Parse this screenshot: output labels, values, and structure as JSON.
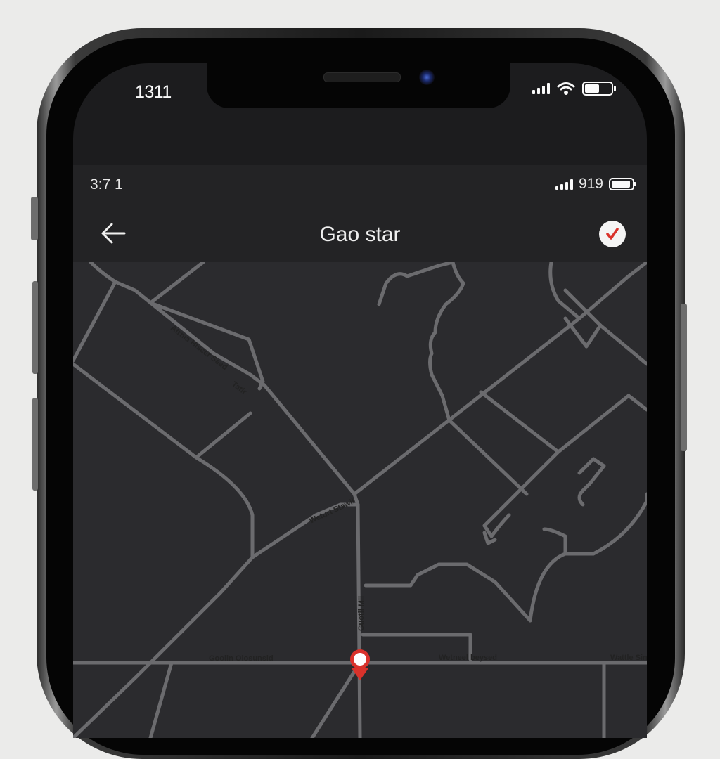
{
  "device": {
    "outer_status": {
      "time": "1311"
    },
    "colors": {
      "map_bg": "#2b2b2e",
      "road": "#6b6b6e",
      "pin": "#d9322b",
      "bar_bg": "#232325"
    }
  },
  "app": {
    "status": {
      "time": "3:7 1",
      "battery_text": "919"
    },
    "header": {
      "title": "Gao star",
      "back_icon": "arrow-left-icon",
      "confirm_icon": "check-icon"
    }
  },
  "map": {
    "street_labels": [
      "Atrnia Hiscer Sead",
      "Tatir",
      "Weturt Stawil",
      "Guotil Mil",
      "Goolin Olosunsid",
      "Wetneel beysed",
      "Wattle Sin"
    ]
  }
}
